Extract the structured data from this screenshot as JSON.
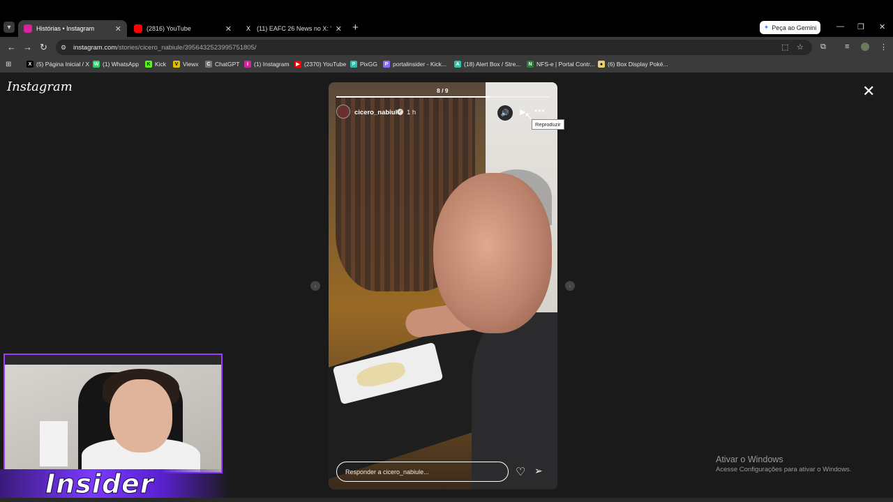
{
  "browser": {
    "tabs": [
      {
        "title": "Histórias • Instagram",
        "active": true,
        "favicon_color": "#d6249f"
      },
      {
        "title": "(2816) YouTube",
        "active": false,
        "favicon_color": "#ff0000"
      },
      {
        "title": "(11) EAFC 26 News no X: \"",
        "active": false,
        "favicon_color": "#000000"
      }
    ],
    "gemini_label": "Peça ao Gemini",
    "url_host": "instagram.com",
    "url_path": "/stories/cicero_nabiule/3956432523995751805/",
    "bookmarks": [
      {
        "label": "(5) Página Inicial / X",
        "icon": "x-icon",
        "color": "#000000",
        "glyph": "X"
      },
      {
        "label": "(1) WhatsApp",
        "icon": "whatsapp-icon",
        "color": "#25d366",
        "glyph": "W"
      },
      {
        "label": "Kick",
        "icon": "kick-icon",
        "color": "#53fc18",
        "glyph": "K"
      },
      {
        "label": "Viewx",
        "icon": "viewx-icon",
        "color": "#e0c000",
        "glyph": "V"
      },
      {
        "label": "ChatGPT",
        "icon": "chatgpt-icon",
        "color": "#777777",
        "glyph": "C"
      },
      {
        "label": "(1) Instagram",
        "icon": "instagram-icon",
        "color": "#d6249f",
        "glyph": "I"
      },
      {
        "label": "(2370) YouTube",
        "icon": "youtube-icon",
        "color": "#ff0000",
        "glyph": "▶"
      },
      {
        "label": "PixGG",
        "icon": "pixgg-icon",
        "color": "#32bcad",
        "glyph": "P"
      },
      {
        "label": "portalinsider - Kick...",
        "icon": "portal-icon",
        "color": "#8a6aff",
        "glyph": "P"
      },
      {
        "label": "(18) Alert Box / Stre...",
        "icon": "alertbox-icon",
        "color": "#31c3a2",
        "glyph": "A"
      },
      {
        "label": "NFS-e | Portal Contr...",
        "icon": "nfse-icon",
        "color": "#2a7a3a",
        "glyph": "N"
      },
      {
        "label": "(6) Box Display Poké...",
        "icon": "pokemon-icon",
        "color": "#e8d070",
        "glyph": "●"
      }
    ]
  },
  "instagram": {
    "logo": "Instagram",
    "story": {
      "counter": "8 / 9",
      "progress": 0.72,
      "username": "cicero_nabiule",
      "time": "1 h",
      "tooltip": "Reproduzir",
      "reply_placeholder": "Responder a cicero_nabiule..."
    }
  },
  "watermark": {
    "line1": "Ativar o Windows",
    "line2": "Acesse Configurações para ativar o Windows."
  },
  "overlay": {
    "brand": "Insider"
  }
}
